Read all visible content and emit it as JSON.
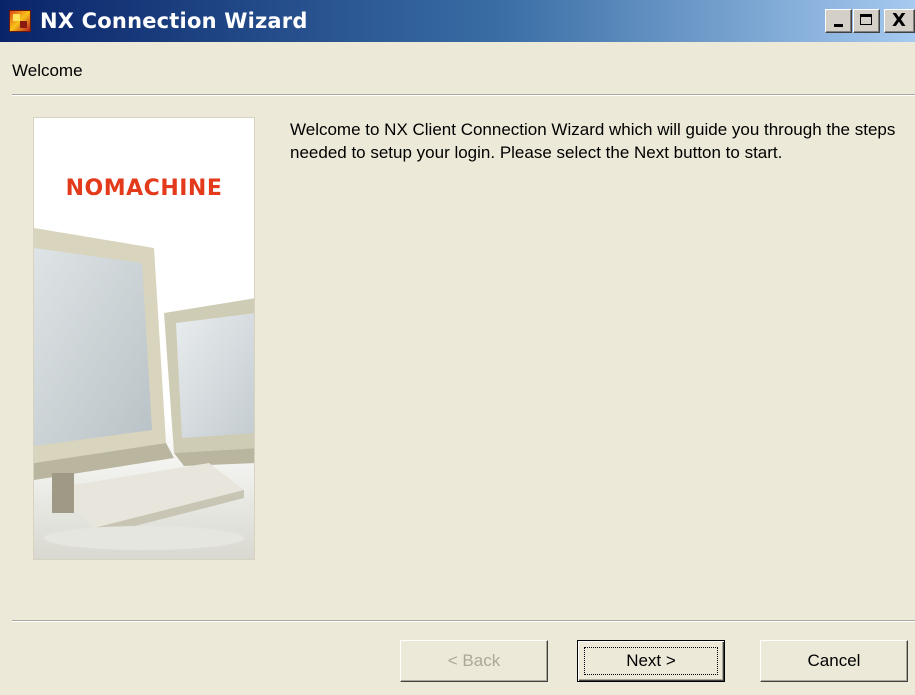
{
  "window": {
    "title": "NX Connection Wizard",
    "icon": "nx-app-icon",
    "controls": {
      "minimize_icon": "minimize-icon",
      "maximize_icon": "maximize-icon",
      "close_icon": "close-icon",
      "close_glyph": "X"
    }
  },
  "header": {
    "title": "Welcome"
  },
  "side_image": {
    "brand": "NOMACHINE",
    "brand_color": "#e23a1a",
    "illustration": "monitors-illustration"
  },
  "content": {
    "text": "Welcome to NX Client Connection Wizard which will guide you through the steps needed to setup your login. Please select the Next button to start."
  },
  "buttons": {
    "back": {
      "label": "< Back",
      "enabled": false
    },
    "next": {
      "label": "Next >",
      "enabled": true,
      "focused": true
    },
    "cancel": {
      "label": "Cancel",
      "enabled": true
    }
  },
  "colors": {
    "dialog_bg": "#ece9d8",
    "titlebar_start": "#0a246a",
    "titlebar_end": "#a6caf0",
    "disabled_text": "#aca899"
  }
}
